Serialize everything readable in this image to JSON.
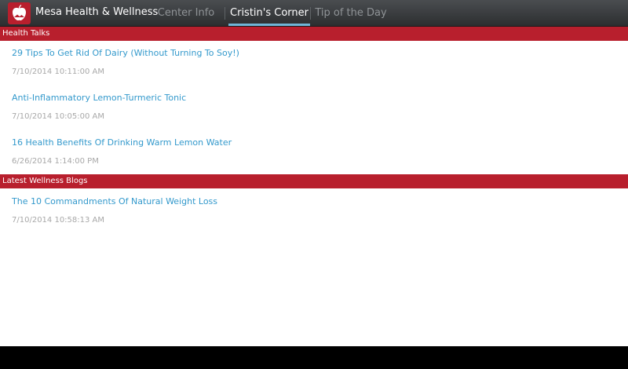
{
  "app": {
    "title": "Mesa Health & Wellness",
    "icon": "apple-logo-icon"
  },
  "tabs": [
    {
      "label": "Center Info",
      "selected": false
    },
    {
      "label": "Cristin's Corner",
      "selected": true
    },
    {
      "label": "Tip of the Day",
      "selected": false
    }
  ],
  "sections": [
    {
      "header": "Health Talks",
      "items": [
        {
          "title": "29 Tips To Get Rid Of Dairy (Without Turning To Soy!)",
          "date": "7/10/2014 10:11:00 AM"
        },
        {
          "title": "Anti-Inflammatory Lemon-Turmeric Tonic",
          "date": "7/10/2014 10:05:00 AM"
        },
        {
          "title": "16 Health Benefits Of Drinking Warm Lemon Water",
          "date": "6/26/2014 1:14:00 PM"
        }
      ]
    },
    {
      "header": "Latest Wellness Blogs",
      "items": [
        {
          "title": "The 10 Commandments Of Natural Weight Loss",
          "date": "7/10/2014 10:58:13 AM"
        }
      ]
    }
  ],
  "colors": {
    "accent_red": "#b81f2d",
    "link_blue": "#3399cc",
    "tab_indicator": "#6fb6d8"
  }
}
